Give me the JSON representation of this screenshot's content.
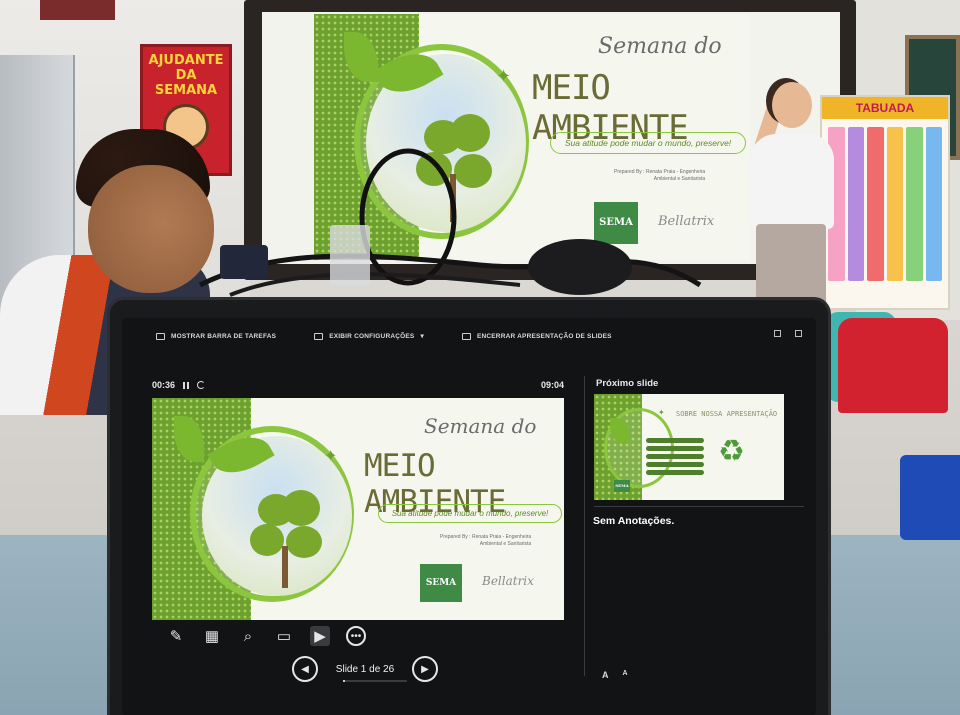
{
  "toolbar": {
    "show_taskbar": "MOSTRAR BARRA DE TAREFAS",
    "display_settings": "EXIBIR CONFIGURAÇÕES",
    "end_show": "ENCERRAR APRESENTAÇÃO DE SLIDES"
  },
  "presenter": {
    "elapsed": "00:36",
    "clock": "09:04",
    "next_slide_label": "Próximo slide",
    "notes": "Sem Anotações.",
    "slide_counter": "Slide 1 de 26",
    "slide_current": 1,
    "slide_total": 26,
    "font_increase": "A",
    "font_decrease": "A"
  },
  "current_slide": {
    "script_title": "Semana do",
    "title": "MEIO AMBIENTE",
    "tagline": "Sua atitude pode mudar o mundo, preserve!",
    "prepared_line1": "Prepared By : Renata Praia - Engenheira",
    "prepared_line2": "Ambiental e Sanitarista",
    "logo_text": "SEMA",
    "signature": "Bellatrix"
  },
  "next_slide": {
    "title": "SOBRE NOSSA APRESENTAÇÃO",
    "badge": "SEMA"
  },
  "posters": {
    "helper": "AJUDANTE DA SEMANA",
    "tables": "TABUADA"
  },
  "icons": {
    "tools": [
      "pen-icon",
      "slides-grid-icon",
      "zoom-icon",
      "pointer-screen-icon",
      "camera-icon",
      "more-options-icon"
    ],
    "nav": [
      "previous-slide-icon",
      "next-slide-icon"
    ]
  },
  "colors": {
    "slide_green": "#6da12f",
    "slide_leaf": "#8cc63f",
    "presenter_bg": "#121315"
  }
}
